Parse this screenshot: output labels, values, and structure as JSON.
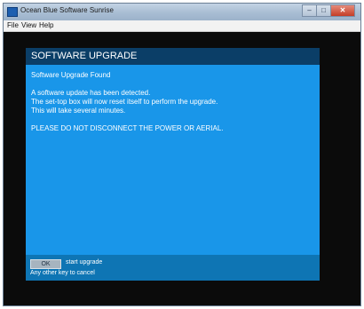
{
  "window": {
    "title": "Ocean Blue Software Sunrise",
    "controls": [
      "–",
      "□",
      "✕"
    ]
  },
  "menu": {
    "items": [
      "File",
      "View",
      "Help"
    ]
  },
  "dialog": {
    "title": "SOFTWARE UPGRADE",
    "subtitle": "Software Upgrade Found",
    "message_lines": [
      "A software update has been detected.",
      "The set-top box will now reset itself to perform the upgrade.",
      "This will take several minutes."
    ],
    "warning": "PLEASE DO NOT DISCONNECT THE POWER OR AERIAL.",
    "ok_label": "OK",
    "start_label": "start upgrade",
    "cancel_hint": "Any other key to cancel"
  },
  "colors": {
    "dialog_body": "#1996e9",
    "dialog_header": "#0b3e67",
    "dialog_footer": "#0e75b4",
    "background": "#0b0b0b"
  },
  "icons": {
    "app": "app-icon",
    "minimize": "minimize-icon",
    "maximize": "maximize-icon",
    "close": "close-icon"
  }
}
